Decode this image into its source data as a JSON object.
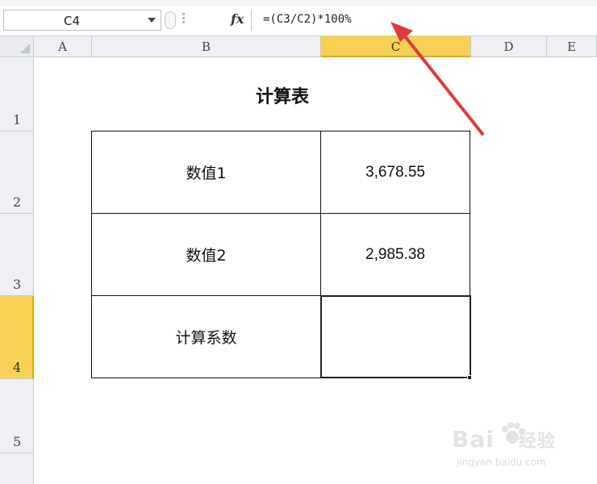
{
  "formula_bar": {
    "name_box": "C4",
    "fx_label": "fx",
    "formula": "=(C3/C2)*100%"
  },
  "columns": [
    "A",
    "B",
    "C",
    "D",
    "E"
  ],
  "active_column": "C",
  "rows": [
    "1",
    "2",
    "3",
    "4",
    "5"
  ],
  "active_row": "4",
  "sheet": {
    "title": "计算表",
    "table": [
      {
        "label": "数值1",
        "value": "3,678.55"
      },
      {
        "label": "数值2",
        "value": "2,985.38"
      },
      {
        "label": "计算系数",
        "value": ""
      }
    ]
  },
  "watermark": {
    "logo": "Bai",
    "logo_suffix": "经验",
    "url": "jingyan.baidu.com"
  },
  "colors": {
    "active_header": "#f7d154",
    "annotation_arrow": "#e23a3a"
  }
}
